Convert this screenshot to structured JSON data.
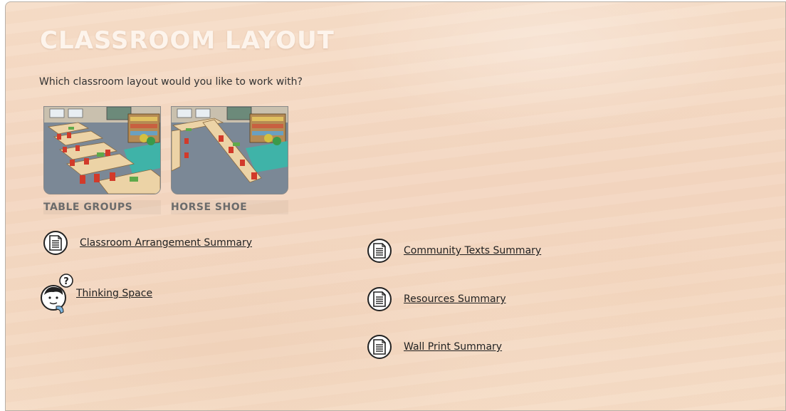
{
  "page": {
    "title": "CLASSROOM LAYOUT",
    "prompt": "Which classroom layout would you like to work with?"
  },
  "layout_options": [
    {
      "label": "TABLE GROUPS",
      "icon": "table-groups-thumbnail"
    },
    {
      "label": "HORSE SHOE",
      "icon": "horse-shoe-thumbnail"
    }
  ],
  "links": {
    "classroom_arrangement": {
      "label": "Classroom Arrangement Summary",
      "icon": "document-icon"
    },
    "thinking_space": {
      "label": "Thinking Space",
      "icon": "thinking-child-icon",
      "bubble": "?"
    },
    "community_texts": {
      "label": "Community Texts Summary",
      "icon": "document-icon"
    },
    "resources": {
      "label": "Resources Summary",
      "icon": "document-icon"
    },
    "wall_print": {
      "label": "Wall Print Summary",
      "icon": "document-icon"
    }
  },
  "colors": {
    "background": "#f5dcc6",
    "title": "#fdf4ec",
    "text": "#222222",
    "label": "#6b6b6b"
  }
}
